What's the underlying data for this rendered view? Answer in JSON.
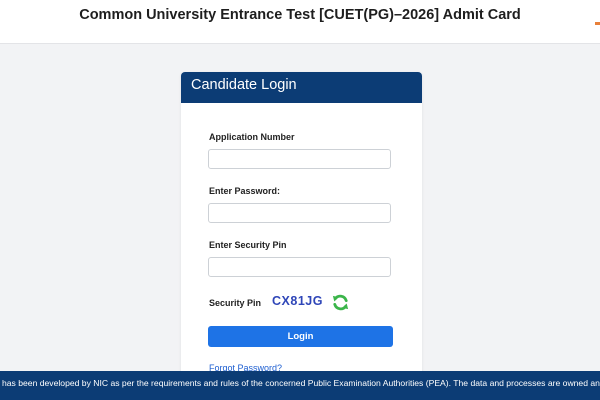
{
  "header": {
    "title": "Common University Entrance Test [CUET(PG)–2026] Admit Card"
  },
  "login_card": {
    "title": "Candidate Login",
    "application_number": {
      "label": "Application Number",
      "value": "",
      "placeholder": ""
    },
    "password": {
      "label": "Enter Password:",
      "value": "",
      "placeholder": ""
    },
    "security_pin_input": {
      "label": "Enter Security Pin",
      "value": "",
      "placeholder": ""
    },
    "captcha": {
      "label": "Security Pin",
      "code": "CX81JG",
      "refresh_icon": "refresh-icon"
    },
    "login_label": "Login",
    "forgot_password": "Forgot Password?"
  },
  "footer": {
    "text": "has been developed by NIC as per the requirements and rules of the concerned Public Examination Authorities (PEA). The data and processes are owned and managed by"
  },
  "colors": {
    "primary_navy": "#0c3c75",
    "button_blue": "#1e73e6",
    "captcha_blue": "#2f46b8",
    "refresh_green": "#3bb54a",
    "link_blue": "#1e5fd1"
  }
}
